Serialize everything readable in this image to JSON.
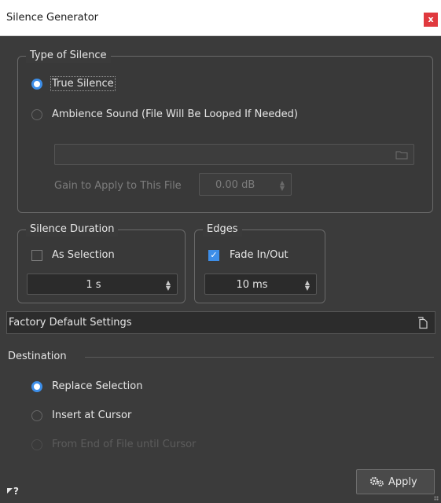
{
  "window": {
    "title": "Silence Generator",
    "close_label": "x"
  },
  "type_of_silence": {
    "legend": "Type of Silence",
    "true_silence": "True Silence",
    "ambience_sound": "Ambience Sound (File Will Be Looped If Needed)",
    "file_path": "",
    "gain_label": "Gain to Apply to This File",
    "gain_value": "0.00 dB",
    "selected": "true_silence"
  },
  "silence_duration": {
    "legend": "Silence Duration",
    "as_selection_label": "As Selection",
    "as_selection_checked": false,
    "duration_value": "1 s"
  },
  "edges": {
    "legend": "Edges",
    "fade_label": "Fade In/Out",
    "fade_checked": true,
    "fade_value": "10 ms"
  },
  "presets": {
    "label": "Factory Default Settings"
  },
  "destination": {
    "label": "Destination",
    "options": [
      "Replace Selection",
      "Insert at Cursor",
      "From End of File until Cursor"
    ],
    "selected": "Replace Selection"
  },
  "footer": {
    "apply_label": "Apply",
    "help_glyph": "?"
  },
  "colors": {
    "accent": "#3d8ee8",
    "close": "#e0393e",
    "background": "#3b3b3b"
  }
}
